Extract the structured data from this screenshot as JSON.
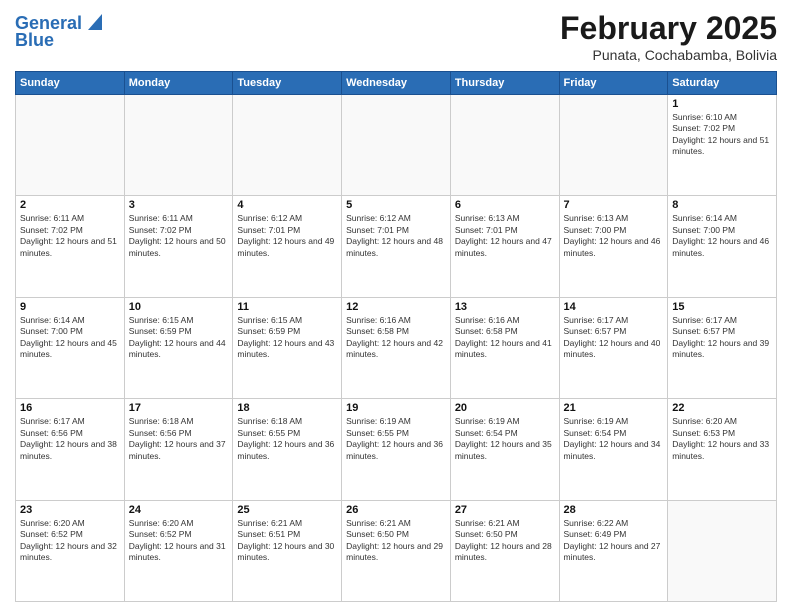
{
  "header": {
    "logo_line1": "General",
    "logo_line2": "Blue",
    "month": "February 2025",
    "location": "Punata, Cochabamba, Bolivia"
  },
  "weekdays": [
    "Sunday",
    "Monday",
    "Tuesday",
    "Wednesday",
    "Thursday",
    "Friday",
    "Saturday"
  ],
  "weeks": [
    [
      {
        "day": "",
        "info": ""
      },
      {
        "day": "",
        "info": ""
      },
      {
        "day": "",
        "info": ""
      },
      {
        "day": "",
        "info": ""
      },
      {
        "day": "",
        "info": ""
      },
      {
        "day": "",
        "info": ""
      },
      {
        "day": "1",
        "info": "Sunrise: 6:10 AM\nSunset: 7:02 PM\nDaylight: 12 hours and 51 minutes."
      }
    ],
    [
      {
        "day": "2",
        "info": "Sunrise: 6:11 AM\nSunset: 7:02 PM\nDaylight: 12 hours and 51 minutes."
      },
      {
        "day": "3",
        "info": "Sunrise: 6:11 AM\nSunset: 7:02 PM\nDaylight: 12 hours and 50 minutes."
      },
      {
        "day": "4",
        "info": "Sunrise: 6:12 AM\nSunset: 7:01 PM\nDaylight: 12 hours and 49 minutes."
      },
      {
        "day": "5",
        "info": "Sunrise: 6:12 AM\nSunset: 7:01 PM\nDaylight: 12 hours and 48 minutes."
      },
      {
        "day": "6",
        "info": "Sunrise: 6:13 AM\nSunset: 7:01 PM\nDaylight: 12 hours and 47 minutes."
      },
      {
        "day": "7",
        "info": "Sunrise: 6:13 AM\nSunset: 7:00 PM\nDaylight: 12 hours and 46 minutes."
      },
      {
        "day": "8",
        "info": "Sunrise: 6:14 AM\nSunset: 7:00 PM\nDaylight: 12 hours and 46 minutes."
      }
    ],
    [
      {
        "day": "9",
        "info": "Sunrise: 6:14 AM\nSunset: 7:00 PM\nDaylight: 12 hours and 45 minutes."
      },
      {
        "day": "10",
        "info": "Sunrise: 6:15 AM\nSunset: 6:59 PM\nDaylight: 12 hours and 44 minutes."
      },
      {
        "day": "11",
        "info": "Sunrise: 6:15 AM\nSunset: 6:59 PM\nDaylight: 12 hours and 43 minutes."
      },
      {
        "day": "12",
        "info": "Sunrise: 6:16 AM\nSunset: 6:58 PM\nDaylight: 12 hours and 42 minutes."
      },
      {
        "day": "13",
        "info": "Sunrise: 6:16 AM\nSunset: 6:58 PM\nDaylight: 12 hours and 41 minutes."
      },
      {
        "day": "14",
        "info": "Sunrise: 6:17 AM\nSunset: 6:57 PM\nDaylight: 12 hours and 40 minutes."
      },
      {
        "day": "15",
        "info": "Sunrise: 6:17 AM\nSunset: 6:57 PM\nDaylight: 12 hours and 39 minutes."
      }
    ],
    [
      {
        "day": "16",
        "info": "Sunrise: 6:17 AM\nSunset: 6:56 PM\nDaylight: 12 hours and 38 minutes."
      },
      {
        "day": "17",
        "info": "Sunrise: 6:18 AM\nSunset: 6:56 PM\nDaylight: 12 hours and 37 minutes."
      },
      {
        "day": "18",
        "info": "Sunrise: 6:18 AM\nSunset: 6:55 PM\nDaylight: 12 hours and 36 minutes."
      },
      {
        "day": "19",
        "info": "Sunrise: 6:19 AM\nSunset: 6:55 PM\nDaylight: 12 hours and 36 minutes."
      },
      {
        "day": "20",
        "info": "Sunrise: 6:19 AM\nSunset: 6:54 PM\nDaylight: 12 hours and 35 minutes."
      },
      {
        "day": "21",
        "info": "Sunrise: 6:19 AM\nSunset: 6:54 PM\nDaylight: 12 hours and 34 minutes."
      },
      {
        "day": "22",
        "info": "Sunrise: 6:20 AM\nSunset: 6:53 PM\nDaylight: 12 hours and 33 minutes."
      }
    ],
    [
      {
        "day": "23",
        "info": "Sunrise: 6:20 AM\nSunset: 6:52 PM\nDaylight: 12 hours and 32 minutes."
      },
      {
        "day": "24",
        "info": "Sunrise: 6:20 AM\nSunset: 6:52 PM\nDaylight: 12 hours and 31 minutes."
      },
      {
        "day": "25",
        "info": "Sunrise: 6:21 AM\nSunset: 6:51 PM\nDaylight: 12 hours and 30 minutes."
      },
      {
        "day": "26",
        "info": "Sunrise: 6:21 AM\nSunset: 6:50 PM\nDaylight: 12 hours and 29 minutes."
      },
      {
        "day": "27",
        "info": "Sunrise: 6:21 AM\nSunset: 6:50 PM\nDaylight: 12 hours and 28 minutes."
      },
      {
        "day": "28",
        "info": "Sunrise: 6:22 AM\nSunset: 6:49 PM\nDaylight: 12 hours and 27 minutes."
      },
      {
        "day": "",
        "info": ""
      }
    ]
  ]
}
